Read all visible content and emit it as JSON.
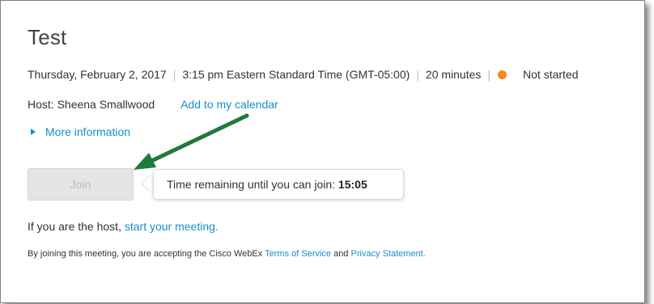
{
  "meeting": {
    "title": "Test",
    "date": "Thursday, February 2, 2017",
    "time": "3:15 pm Eastern Standard Time (GMT-05:00)",
    "duration": "20 minutes",
    "status": "Not started",
    "status_color": "#f5891f",
    "separator": "|"
  },
  "host": {
    "label": "Host: Sheena Smallwood",
    "add_calendar": "Add to my calendar"
  },
  "more_info": {
    "label": "More information",
    "icon": "caret-right-icon"
  },
  "join": {
    "button_label": "Join",
    "tooltip_text": "Time remaining until you can join: ",
    "tooltip_time": "15:05"
  },
  "host_start": {
    "prefix": "If you are the host, ",
    "link": "start your meeting."
  },
  "disclaimer": {
    "prefix": "By joining this meeting, you are accepting the Cisco WebEx ",
    "terms": "Terms of Service",
    "and": " and ",
    "privacy": "Privacy Statement."
  },
  "colors": {
    "link": "#1a8ccc",
    "annotation_arrow": "#1e7a3c"
  },
  "annotation": {
    "icon": "green-arrow-icon"
  }
}
